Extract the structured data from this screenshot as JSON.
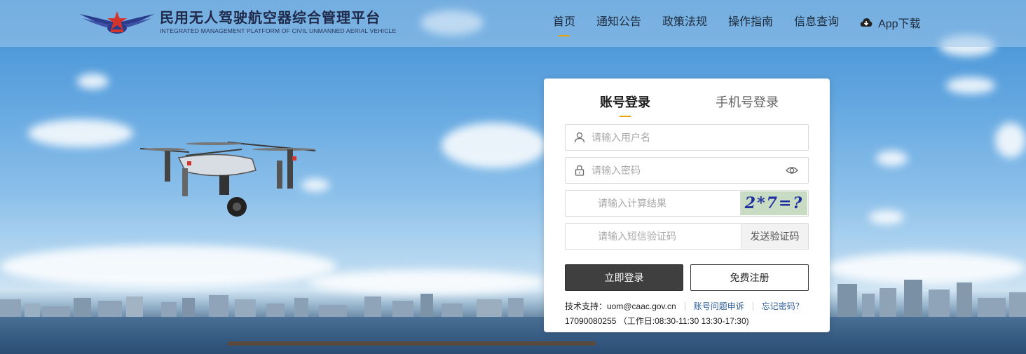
{
  "header": {
    "logo_title": "民用无人驾驶航空器综合管理平台",
    "logo_subtitle": "INTEGRATED MANAGEMENT PLATFORM OF CIVIL UNMANNED AERIAL VEHICLE",
    "nav": [
      "首页",
      "通知公告",
      "政策法规",
      "操作指南",
      "信息查询"
    ],
    "active_nav": "首页",
    "app_download": "App下载"
  },
  "login": {
    "tab_account": "账号登录",
    "tab_phone": "手机号登录",
    "username_placeholder": "请输入用户名",
    "password_placeholder": "请输入密码",
    "calc_placeholder": "请输入计算结果",
    "captcha_text": "2*7=?",
    "sms_placeholder": "请输入短信验证码",
    "send_code": "发送验证码",
    "login_button": "立即登录",
    "register_button": "免费注册",
    "support_label": "技术支持：uom@caac.gov.cn",
    "appeal_link": "账号问题申诉",
    "forgot_link": "忘记密码？",
    "phone_hours": "17090080255 （工作日:08:30-11:30 13:30-17:30)"
  },
  "colors": {
    "accent": "#e9a300",
    "login_button": "#3f3f3f",
    "link": "#2f5f9e"
  },
  "icons": [
    "user-icon",
    "lock-icon",
    "eye-icon",
    "cloud-download-icon",
    "emblem-logo"
  ]
}
